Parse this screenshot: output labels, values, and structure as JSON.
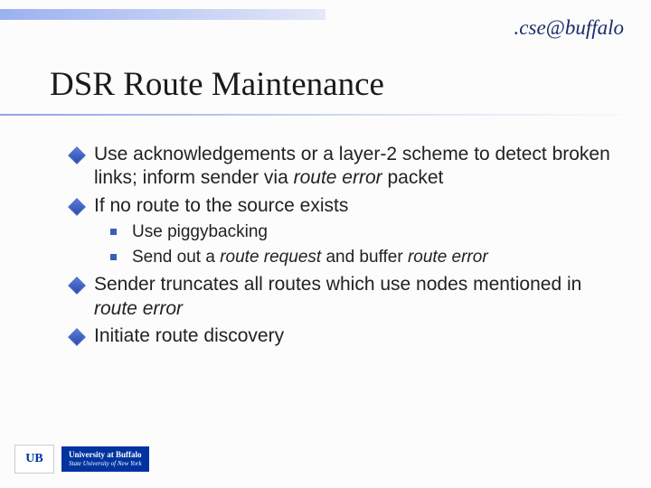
{
  "branding": {
    "top_right": ".cse@buffalo",
    "footer_mark": "UB",
    "footer_line1": "University at Buffalo",
    "footer_line2": "State University of New York"
  },
  "title": "DSR Route Maintenance",
  "bullets": {
    "b1a": "Use acknowledgements or a layer-2 scheme to detect broken links; inform sender via ",
    "b1b": "route error",
    "b1c": " packet",
    "b2": "If no route to the source exists",
    "s1": "Use piggybacking",
    "s2a": "Send out a ",
    "s2b": "route request",
    "s2c": " and buffer ",
    "s2d": "route error",
    "b3a": "Sender truncates all routes which use nodes mentioned in ",
    "b3b": "route error",
    "b4": "Initiate route discovery"
  }
}
